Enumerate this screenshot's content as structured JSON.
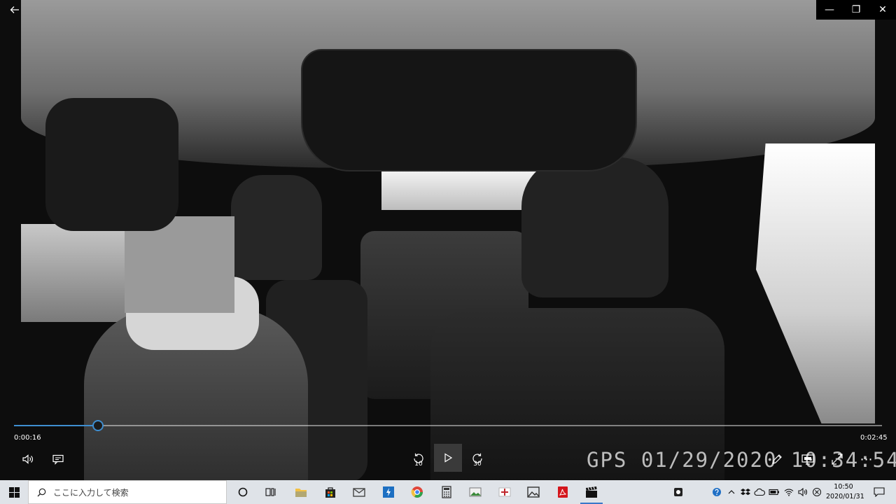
{
  "window": {
    "back_icon": "back-arrow-icon",
    "minimize_glyph": "—",
    "maximize_glyph": "❐",
    "close_glyph": "✕"
  },
  "video": {
    "osd_text": "GPS 01/29/2020 10:34:54"
  },
  "player": {
    "current_time": "0:00:16",
    "total_time": "0:02:45",
    "progress_fraction": 0.097,
    "rewind_seconds": "10",
    "forward_seconds": "30",
    "more_glyph": "⋯",
    "accent_color": "#3e8ed0",
    "icons": [
      "volume-icon",
      "captions-icon",
      "rewind-10-icon",
      "play-icon",
      "forward-30-icon",
      "edit-pen-icon",
      "cast-icon",
      "fullscreen-icon",
      "more-icon"
    ]
  },
  "taskbar": {
    "search_placeholder": "ここに入力して検索",
    "clock_time": "10:50",
    "clock_date": "2020/01/31",
    "apps": [
      {
        "name": "file-explorer",
        "icon": "folder-icon",
        "color": "#f3c043"
      },
      {
        "name": "microsoft-store",
        "icon": "store-bag-icon",
        "color": "#222222"
      },
      {
        "name": "mail",
        "icon": "mail-icon",
        "color": "#444444"
      },
      {
        "name": "lightning-app",
        "icon": "lightning-icon",
        "color": "#1c6fc2"
      },
      {
        "name": "chrome",
        "icon": "chrome-icon",
        "color": "#e0463a"
      },
      {
        "name": "calculator",
        "icon": "calculator-icon",
        "color": "#333333"
      },
      {
        "name": "photo-viewer",
        "icon": "landscape-icon",
        "color": "#3a8a3a"
      },
      {
        "name": "red-app",
        "icon": "red-shield-icon",
        "color": "#c0272d"
      },
      {
        "name": "photos",
        "icon": "image-icon",
        "color": "#333333"
      },
      {
        "name": "acrobat",
        "icon": "pdf-icon",
        "color": "#d4161c"
      },
      {
        "name": "movies-tv",
        "icon": "clapper-icon",
        "color": "#111111"
      }
    ],
    "tray_icons": [
      "app-tray-icon",
      "help-icon",
      "chevron-up-icon",
      "dropbox-icon",
      "cloud-icon",
      "battery-icon",
      "wifi-icon",
      "speaker-icon",
      "disconnected-icon"
    ]
  }
}
